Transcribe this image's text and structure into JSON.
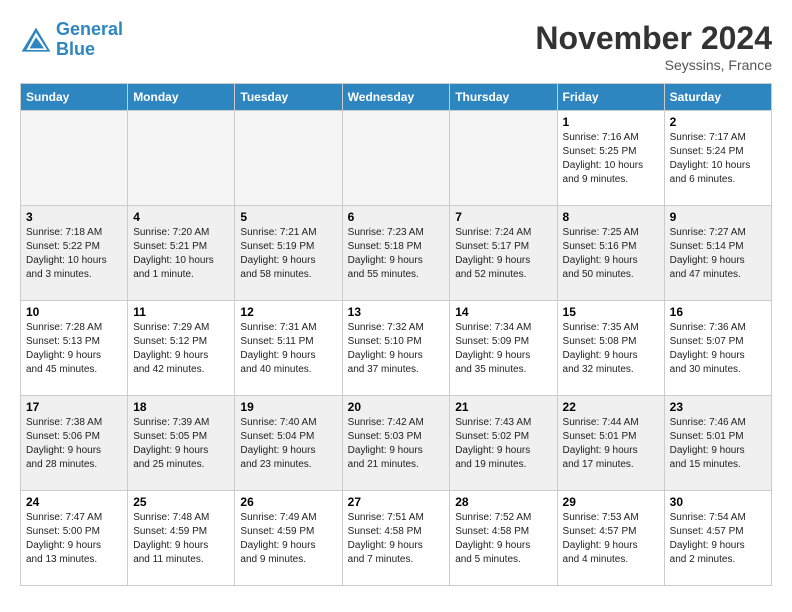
{
  "logo": {
    "line1": "General",
    "line2": "Blue"
  },
  "title": "November 2024",
  "location": "Seyssins, France",
  "weekdays": [
    "Sunday",
    "Monday",
    "Tuesday",
    "Wednesday",
    "Thursday",
    "Friday",
    "Saturday"
  ],
  "weeks": [
    [
      {
        "day": "",
        "info": ""
      },
      {
        "day": "",
        "info": ""
      },
      {
        "day": "",
        "info": ""
      },
      {
        "day": "",
        "info": ""
      },
      {
        "day": "",
        "info": ""
      },
      {
        "day": "1",
        "info": "Sunrise: 7:16 AM\nSunset: 5:25 PM\nDaylight: 10 hours\nand 9 minutes."
      },
      {
        "day": "2",
        "info": "Sunrise: 7:17 AM\nSunset: 5:24 PM\nDaylight: 10 hours\nand 6 minutes."
      }
    ],
    [
      {
        "day": "3",
        "info": "Sunrise: 7:18 AM\nSunset: 5:22 PM\nDaylight: 10 hours\nand 3 minutes."
      },
      {
        "day": "4",
        "info": "Sunrise: 7:20 AM\nSunset: 5:21 PM\nDaylight: 10 hours\nand 1 minute."
      },
      {
        "day": "5",
        "info": "Sunrise: 7:21 AM\nSunset: 5:19 PM\nDaylight: 9 hours\nand 58 minutes."
      },
      {
        "day": "6",
        "info": "Sunrise: 7:23 AM\nSunset: 5:18 PM\nDaylight: 9 hours\nand 55 minutes."
      },
      {
        "day": "7",
        "info": "Sunrise: 7:24 AM\nSunset: 5:17 PM\nDaylight: 9 hours\nand 52 minutes."
      },
      {
        "day": "8",
        "info": "Sunrise: 7:25 AM\nSunset: 5:16 PM\nDaylight: 9 hours\nand 50 minutes."
      },
      {
        "day": "9",
        "info": "Sunrise: 7:27 AM\nSunset: 5:14 PM\nDaylight: 9 hours\nand 47 minutes."
      }
    ],
    [
      {
        "day": "10",
        "info": "Sunrise: 7:28 AM\nSunset: 5:13 PM\nDaylight: 9 hours\nand 45 minutes."
      },
      {
        "day": "11",
        "info": "Sunrise: 7:29 AM\nSunset: 5:12 PM\nDaylight: 9 hours\nand 42 minutes."
      },
      {
        "day": "12",
        "info": "Sunrise: 7:31 AM\nSunset: 5:11 PM\nDaylight: 9 hours\nand 40 minutes."
      },
      {
        "day": "13",
        "info": "Sunrise: 7:32 AM\nSunset: 5:10 PM\nDaylight: 9 hours\nand 37 minutes."
      },
      {
        "day": "14",
        "info": "Sunrise: 7:34 AM\nSunset: 5:09 PM\nDaylight: 9 hours\nand 35 minutes."
      },
      {
        "day": "15",
        "info": "Sunrise: 7:35 AM\nSunset: 5:08 PM\nDaylight: 9 hours\nand 32 minutes."
      },
      {
        "day": "16",
        "info": "Sunrise: 7:36 AM\nSunset: 5:07 PM\nDaylight: 9 hours\nand 30 minutes."
      }
    ],
    [
      {
        "day": "17",
        "info": "Sunrise: 7:38 AM\nSunset: 5:06 PM\nDaylight: 9 hours\nand 28 minutes."
      },
      {
        "day": "18",
        "info": "Sunrise: 7:39 AM\nSunset: 5:05 PM\nDaylight: 9 hours\nand 25 minutes."
      },
      {
        "day": "19",
        "info": "Sunrise: 7:40 AM\nSunset: 5:04 PM\nDaylight: 9 hours\nand 23 minutes."
      },
      {
        "day": "20",
        "info": "Sunrise: 7:42 AM\nSunset: 5:03 PM\nDaylight: 9 hours\nand 21 minutes."
      },
      {
        "day": "21",
        "info": "Sunrise: 7:43 AM\nSunset: 5:02 PM\nDaylight: 9 hours\nand 19 minutes."
      },
      {
        "day": "22",
        "info": "Sunrise: 7:44 AM\nSunset: 5:01 PM\nDaylight: 9 hours\nand 17 minutes."
      },
      {
        "day": "23",
        "info": "Sunrise: 7:46 AM\nSunset: 5:01 PM\nDaylight: 9 hours\nand 15 minutes."
      }
    ],
    [
      {
        "day": "24",
        "info": "Sunrise: 7:47 AM\nSunset: 5:00 PM\nDaylight: 9 hours\nand 13 minutes."
      },
      {
        "day": "25",
        "info": "Sunrise: 7:48 AM\nSunset: 4:59 PM\nDaylight: 9 hours\nand 11 minutes."
      },
      {
        "day": "26",
        "info": "Sunrise: 7:49 AM\nSunset: 4:59 PM\nDaylight: 9 hours\nand 9 minutes."
      },
      {
        "day": "27",
        "info": "Sunrise: 7:51 AM\nSunset: 4:58 PM\nDaylight: 9 hours\nand 7 minutes."
      },
      {
        "day": "28",
        "info": "Sunrise: 7:52 AM\nSunset: 4:58 PM\nDaylight: 9 hours\nand 5 minutes."
      },
      {
        "day": "29",
        "info": "Sunrise: 7:53 AM\nSunset: 4:57 PM\nDaylight: 9 hours\nand 4 minutes."
      },
      {
        "day": "30",
        "info": "Sunrise: 7:54 AM\nSunset: 4:57 PM\nDaylight: 9 hours\nand 2 minutes."
      }
    ]
  ]
}
